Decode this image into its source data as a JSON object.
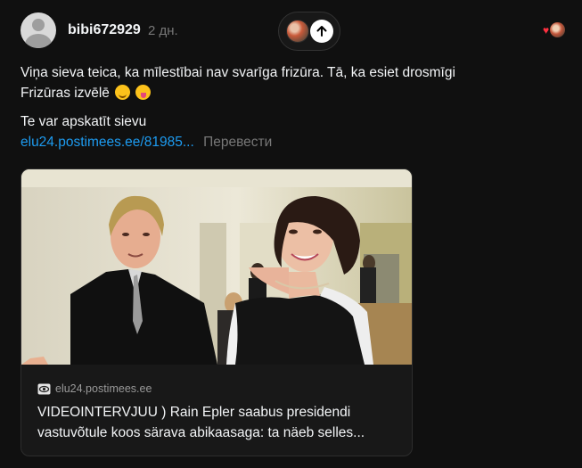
{
  "post": {
    "username": "bibi672929",
    "time": "2 дн.",
    "text_line1": "Viņa sieva teica, ka mīlestībai nav svarīga frizūra. Tā, ka esiet drosmīgi",
    "text_line2": "Frizūras izvēlē",
    "text_line3": "Te var apskatīt sievu",
    "link": "elu24.postimees.ee/81985...",
    "translate": "Перевести"
  },
  "icons": {
    "avatar": "default-user-avatar",
    "repost": "arrow-up-icon",
    "reaction": "heart-icon",
    "emoji1": "smiling-face-with-blush",
    "emoji2": "face-with-tongue",
    "domain_icon": "eye-icon"
  },
  "link_card": {
    "domain": "elu24.postimees.ee",
    "headline": "VIDEOINTERVJUU ) Rain Epler saabus presidendi vastuvõtule koos särava abikaasaga: ta näeb selles..."
  },
  "colors": {
    "background": "#101010",
    "text": "#f3f5f7",
    "muted": "#777777",
    "link": "#1d9bf0",
    "heart": "#ff3040"
  }
}
